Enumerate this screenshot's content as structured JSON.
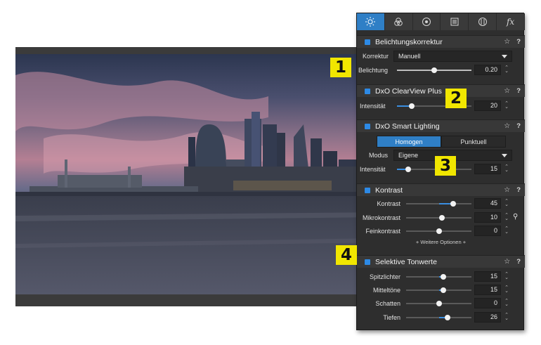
{
  "tabs": [
    {
      "icon": "sun-icon"
    },
    {
      "icon": "color-circles-icon"
    },
    {
      "icon": "lens-icon"
    },
    {
      "icon": "layers-icon"
    },
    {
      "icon": "geometry-icon"
    },
    {
      "icon": "effects-icon",
      "label": "fx"
    }
  ],
  "sections": {
    "exposure": {
      "title": "Belichtungskorrektur",
      "correction_label": "Korrektur",
      "correction_value": "Manuell",
      "exposure_label": "Belichtung",
      "exposure_value": "0.20",
      "exposure_level": 0.5
    },
    "clearview": {
      "title": "DxO ClearView Plus",
      "intensity_label": "Intensität",
      "intensity_value": "20",
      "intensity_level": 0.2
    },
    "smart_lighting": {
      "title": "DxO Smart Lighting",
      "mode_homogeneous": "Homogen",
      "mode_spot": "Punktuell",
      "modus_label": "Modus",
      "modus_value": "Eigene",
      "intensity_label": "Intensität",
      "intensity_value": "15",
      "intensity_level": 0.15
    },
    "contrast": {
      "title": "Kontrast",
      "contrast_label": "Kontrast",
      "contrast_value": "45",
      "contrast_level": 0.72,
      "micro_label": "Mikrokontrast",
      "micro_value": "10",
      "micro_level": 0.55,
      "fine_label": "Feinkontrast",
      "fine_value": "0",
      "fine_level": 0.5,
      "more_options": "+ Weitere Optionen +"
    },
    "tones": {
      "title": "Selektive Tonwerte",
      "highlights_label": "Spitzlichter",
      "highlights_value": "15",
      "highlights_level": 0.57,
      "midtones_label": "Mitteltöne",
      "midtones_value": "15",
      "midtones_level": 0.57,
      "shadows_label": "Schatten",
      "shadows_value": "0",
      "shadows_level": 0.5,
      "depths_label": "Tiefen",
      "depths_value": "26",
      "depths_level": 0.63
    }
  },
  "badges": [
    "1",
    "2",
    "3",
    "4"
  ],
  "colors": {
    "accent": "#2f7fc6",
    "badge": "#f1e600",
    "panel": "#2e2e2e"
  }
}
